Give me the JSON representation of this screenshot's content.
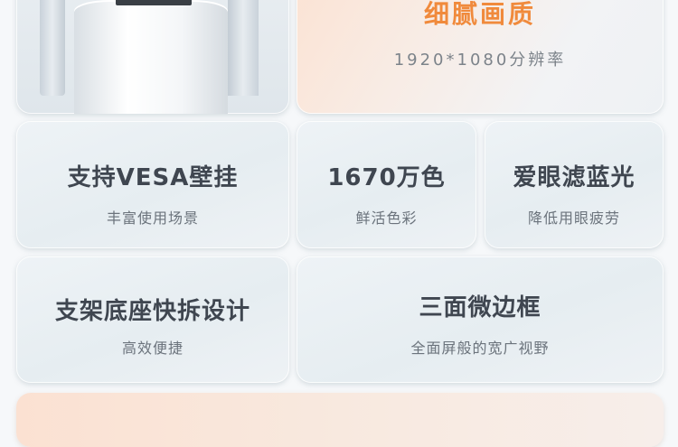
{
  "hero": {
    "headline": "细腻画质",
    "resolution": "1920*1080分辨率"
  },
  "features": [
    {
      "title": "支持VESA壁挂",
      "subtitle": "丰富使用场景"
    },
    {
      "title": "1670万色",
      "subtitle": "鲜活色彩"
    },
    {
      "title": "爱眼滤蓝光",
      "subtitle": "降低用眼疲劳"
    },
    {
      "title": "支架底座快拆设计",
      "subtitle": "高效便捷"
    },
    {
      "title": "三面微边框",
      "subtitle": "全面屏般的宽广视野"
    }
  ],
  "colors": {
    "accent": "#f08a3c",
    "title_text": "#3f4650",
    "sub_text": "#6b737c"
  }
}
